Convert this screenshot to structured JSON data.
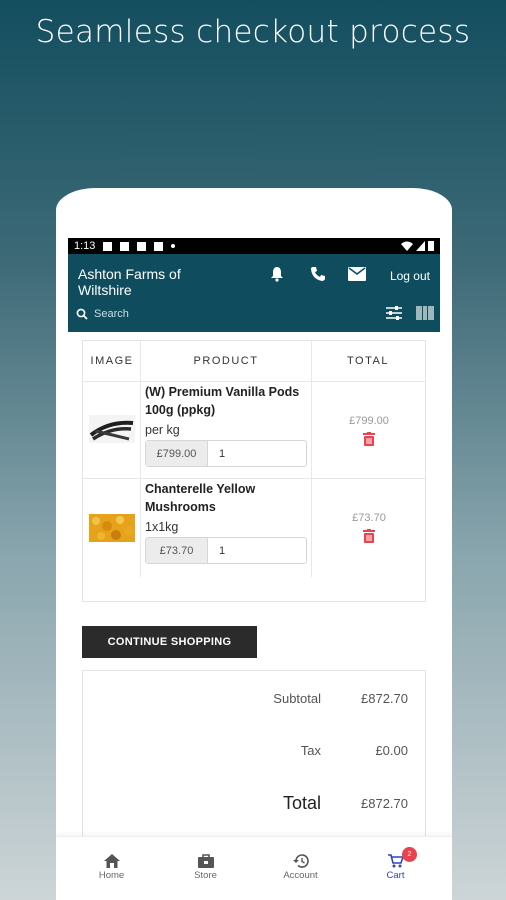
{
  "headline": "Seamless checkout process",
  "status_bar": {
    "time": "1:13"
  },
  "app_bar": {
    "store_name": "Ashton Farms of Wiltshire",
    "logout_label": "Log out",
    "search_placeholder": "Search"
  },
  "cart": {
    "headers": [
      "IMAGE",
      "PRODUCT",
      "TOTAL"
    ],
    "items": [
      {
        "name": "(W) Premium Vanilla Pods 100g (ppkg)",
        "unit": "per kg",
        "price": "£799.00",
        "qty": "1",
        "total": "£799.00"
      },
      {
        "name": "Chanterelle Yellow Mushrooms",
        "unit": "1x1kg",
        "price": "£73.70",
        "qty": "1",
        "total": "£73.70"
      }
    ]
  },
  "continue_label": "CONTINUE SHOPPING",
  "summary": {
    "subtotal_label": "Subtotal",
    "subtotal": "£872.70",
    "tax_label": "Tax",
    "tax": "£0.00",
    "total_label": "Total",
    "total": "£872.70"
  },
  "nav": {
    "items": [
      "Home",
      "Store",
      "Account",
      "Cart"
    ],
    "active": "Cart",
    "cart_badge": "2"
  },
  "colors": {
    "app_bar": "#0f4d5e",
    "accent": "#2b44c7",
    "danger": "#e8434f"
  }
}
